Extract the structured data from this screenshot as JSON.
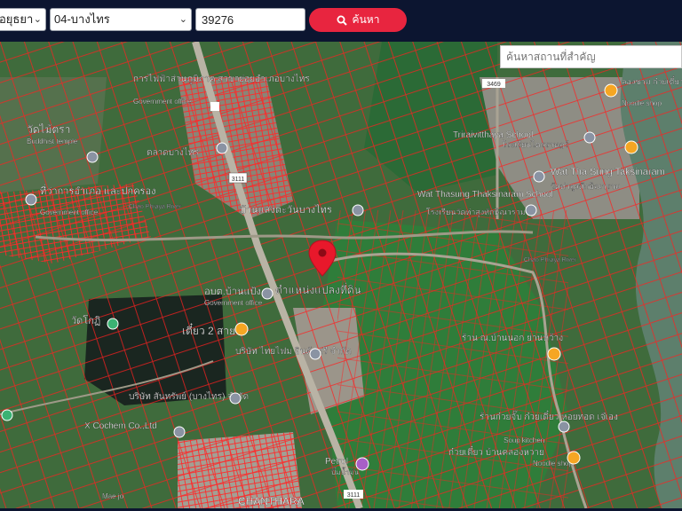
{
  "toolbar": {
    "province_value": "อยุธยา",
    "district_value": "04-บางไทร",
    "deed_number_value": "39276",
    "search_label": "ค้นหา"
  },
  "map": {
    "place_search_placeholder": "ค้นหาสถานที่สำคัญ",
    "location_label": "ตำแหน่งแปลงที่ดิน",
    "labels": {
      "electric": "การไฟฟ้าส่วนภูมิภาค สาขาย่อยอำเภอบางไทร",
      "gov_office_1": "Government office",
      "wat_sai_to": "วัดไม้ตรา",
      "buddhist_temple": "Buddhist temple",
      "talat": "ตลาดบางไทร",
      "district_office": "ที่ว่าการอำเภอ และปกครอง",
      "gov_office_2": "Government office",
      "road_3111_a": "3111",
      "road_3111_b": "3111",
      "road_3111_c": "3111",
      "road_3469": "3469",
      "chao_phraya_1": "Chao Phraya River",
      "chao_phraya_2": "Chao Phraya River",
      "school_tri": "Triraivitthaya School",
      "school_tri_th": "โรงเรียนไตรราษฎร์",
      "wat_tha_sung": "Wat Tha Sung Taksinaram",
      "wat_tha_sung_th": "วัดท่าสูงทักษิณาราม",
      "wat_thasung_2": "Wat Thasung Thaksinaram School",
      "wat_thasung_2_th": "โรงเรียนวัดท่าสูงทักษิณาราม",
      "noodle_top": "ลองชาม ก๋วยเตี๋ยวเรือหอยขม",
      "noodle_top_en": "Noodle shop",
      "bangtrai_market": "บ้านแสงตะวันบางไทร",
      "abt": "อบต.บ้านแป้ง",
      "gov_office_3": "Government office",
      "tiow_2": "เตี๋ยว 2 สาย",
      "thai_sakhon": "บริษัท ไทยไฟม อินดัสตรี จำกัด",
      "sanchon": "บริษัท สันทรัพย์ (บางไทร) จำกัด",
      "x_cochem": "X Cochem Co.,Ltd",
      "shop_ban_nok": "ร้าน ณ.บ้านนอก ย่านหว้าง",
      "kuay_chap": "ร้านก๋วยจั๊บ ก๋วยเตี๋ยว หอยทอด เจ๊เอง",
      "soup_kitchen": "Soup kitchen",
      "kuay_tiow_ban": "ก๋วยเตี๋ยว บ้านคลองหวาย",
      "noodle_bottom": "Noodle shop",
      "petrol": "Petrol",
      "petrol_th": "ปั๊มน้ำมัน",
      "chanthara": "CHANTHARA",
      "wat_sing": "วัดโกฏิ",
      "maejo": "Mae jo"
    }
  },
  "colors": {
    "topbar": "#0c1530",
    "search_button": "#e8253f",
    "parcel_lines": "#ff1f1f",
    "marker": "#e8182b",
    "pin_orange": "#f5a623",
    "pin_gray": "#8a93a3"
  }
}
